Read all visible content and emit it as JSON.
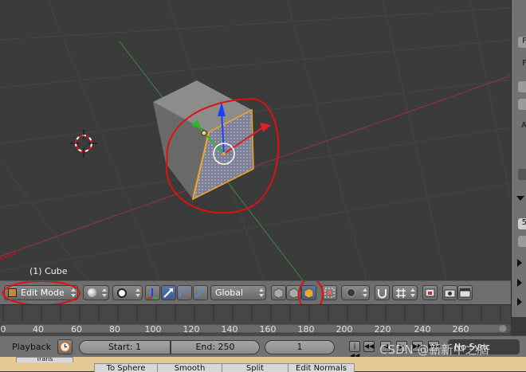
{
  "viewport": {
    "object_label": "(1) Cube"
  },
  "view_header": {
    "mode_label": "Edit Mode",
    "orientation_label": "Global"
  },
  "timeline": {
    "ticks": [
      "0",
      "40",
      "60",
      "80",
      "100",
      "120",
      "140",
      "160",
      "180",
      "200",
      "220",
      "240",
      "260"
    ]
  },
  "timeline_header": {
    "playback_label": "Playback",
    "start_label": "Start: 1",
    "end_label": "End: 250",
    "current_frame": "1",
    "sync_label": "No Sync",
    "play_controls": [
      "|◀◀",
      "◀◀",
      "◀",
      "▶",
      "▶▶",
      "▶▶|"
    ]
  },
  "bottom_tabs": [
    "Trans",
    "To Sphere",
    "Smooth",
    "Split",
    "Edit Normals"
  ],
  "right_panel": {
    "visible_chars": [
      "F",
      "F",
      "A",
      "5"
    ]
  },
  "watermark": "CSDN @新新中之脑",
  "colors": {
    "viewport_bg": "#3b3b3b",
    "selection_orange": "#f5a623",
    "annotation_red": "#e01010",
    "axis_blue": "#1f3fff",
    "axis_green": "#22bb22",
    "axis_red": "#dd2222"
  },
  "icons": {
    "mode_icon": "edit-mode-icon",
    "shading": "viewport-shading-sphere-icon",
    "pivot": "pivot-point-icon",
    "manipulator": "transform-manipulator-icon",
    "select_face": "face-select-icon",
    "clock": "clock-icon",
    "render": "render-icon"
  }
}
